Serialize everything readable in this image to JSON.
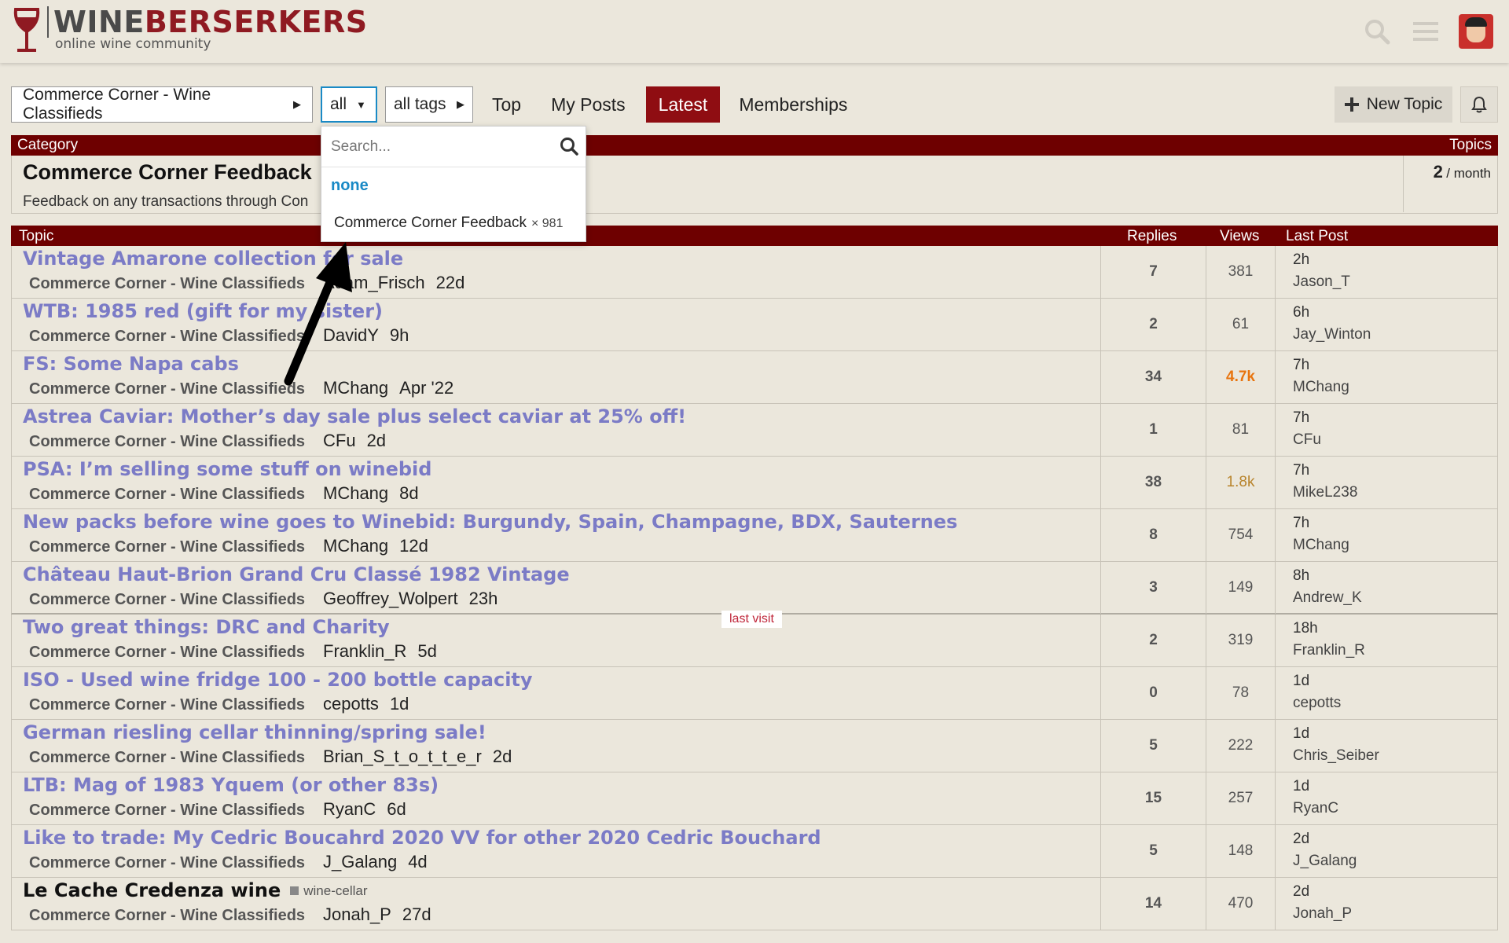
{
  "brand": {
    "name_part1": "WINE",
    "name_part2": "BERSERKERS",
    "tagline": "online wine community"
  },
  "colors": {
    "header_bar": "#6e0000",
    "active_nav": "#8f0d12",
    "link_title": "#7b7bc6",
    "none_link": "#1a8ac6",
    "hot_views": "#e8740e"
  },
  "header_icons": [
    "search-icon",
    "hamburger-menu-icon",
    "avatar"
  ],
  "nav": {
    "category_dropdown": "Commerce Corner - Wine Classifieds",
    "subcategory_dropdown": "all",
    "tags_dropdown": "all tags",
    "links": [
      "Top",
      "My Posts",
      "Latest",
      "Memberships"
    ],
    "active": "Latest",
    "new_topic": "New Topic"
  },
  "dropdown_menu": {
    "search_placeholder": "Search...",
    "none_label": "none",
    "item_label": "Commerce Corner Feedback",
    "item_count": "× 981"
  },
  "category_table": {
    "header_left": "Category",
    "header_right": "Topics",
    "name": "Commerce Corner Feedback",
    "description": "Feedback on any transactions through Con",
    "topics_count": "2",
    "topics_unit": "/ month"
  },
  "topic_table": {
    "headers": {
      "topic": "Topic",
      "replies": "Replies",
      "views": "Views",
      "last_post": "Last Post"
    },
    "last_visit_label": "last visit",
    "rows": [
      {
        "title": "Vintage Amarone collection for sale",
        "category": "Commerce Corner - Wine Classifieds",
        "author": "Adam_Frisch",
        "age": "22d",
        "replies": "7",
        "views": "381",
        "lp_age": "2h",
        "lp_user": "Jason_T"
      },
      {
        "title": "WTB: 1985 red (gift for my sister)",
        "category": "Commerce Corner - Wine Classifieds",
        "author": "DavidY",
        "age": "9h",
        "replies": "2",
        "views": "61",
        "lp_age": "6h",
        "lp_user": "Jay_Winton"
      },
      {
        "title": "FS: Some Napa cabs",
        "category": "Commerce Corner - Wine Classifieds",
        "author": "MChang",
        "age": "Apr '22",
        "replies": "34",
        "views": "4.7k",
        "lp_age": "7h",
        "lp_user": "MChang"
      },
      {
        "title": "Astrea Caviar: Mother’s day sale plus select caviar at 25% off!",
        "category": "Commerce Corner - Wine Classifieds",
        "author": "CFu",
        "age": "2d",
        "replies": "1",
        "views": "81",
        "lp_age": "7h",
        "lp_user": "CFu"
      },
      {
        "title": "PSA: I’m selling some stuff on winebid",
        "category": "Commerce Corner - Wine Classifieds",
        "author": "MChang",
        "age": "8d",
        "replies": "38",
        "views": "1.8k",
        "lp_age": "7h",
        "lp_user": "MikeL238"
      },
      {
        "title": "New packs before wine goes to Winebid: Burgundy, Spain, Champagne, BDX, Sauternes",
        "category": "Commerce Corner - Wine Classifieds",
        "author": "MChang",
        "age": "12d",
        "replies": "8",
        "views": "754",
        "lp_age": "7h",
        "lp_user": "MChang"
      },
      {
        "title": "Château Haut-Brion Grand Cru Classé 1982 Vintage",
        "category": "Commerce Corner - Wine Classifieds",
        "author": "Geoffrey_Wolpert",
        "age": "23h",
        "replies": "3",
        "views": "149",
        "lp_age": "8h",
        "lp_user": "Andrew_K"
      },
      {
        "title": "Two great things: DRC and Charity",
        "category": "Commerce Corner - Wine Classifieds",
        "author": "Franklin_R",
        "age": "5d",
        "replies": "2",
        "views": "319",
        "lp_age": "18h",
        "lp_user": "Franklin_R"
      },
      {
        "title": "ISO - Used wine fridge 100 - 200 bottle capacity",
        "category": "Commerce Corner - Wine Classifieds",
        "author": "cepotts",
        "age": "1d",
        "replies": "0",
        "views": "78",
        "lp_age": "1d",
        "lp_user": "cepotts"
      },
      {
        "title": "German riesling cellar thinning/spring sale!",
        "category": "Commerce Corner - Wine Classifieds",
        "author": "Brian_S_t_o_t_t_e_r",
        "age": "2d",
        "replies": "5",
        "views": "222",
        "lp_age": "1d",
        "lp_user": "Chris_Seiber"
      },
      {
        "title": "LTB: Mag of 1983 Yquem (or other 83s)",
        "category": "Commerce Corner - Wine Classifieds",
        "author": "RyanC",
        "age": "6d",
        "replies": "15",
        "views": "257",
        "lp_age": "1d",
        "lp_user": "RyanC"
      },
      {
        "title": "Like to trade: My Cedric Boucahrd 2020 VV for other 2020 Cedric Bouchard",
        "category": "Commerce Corner - Wine Classifieds",
        "author": "J_Galang",
        "age": "4d",
        "replies": "5",
        "views": "148",
        "lp_age": "2d",
        "lp_user": "J_Galang"
      },
      {
        "title": "Le Cache Credenza wine",
        "tag": "wine-cellar",
        "category": "Commerce Corner - Wine Classifieds",
        "author": "Jonah_P",
        "age": "27d",
        "replies": "14",
        "views": "470",
        "lp_age": "2d",
        "lp_user": "Jonah_P"
      }
    ]
  }
}
